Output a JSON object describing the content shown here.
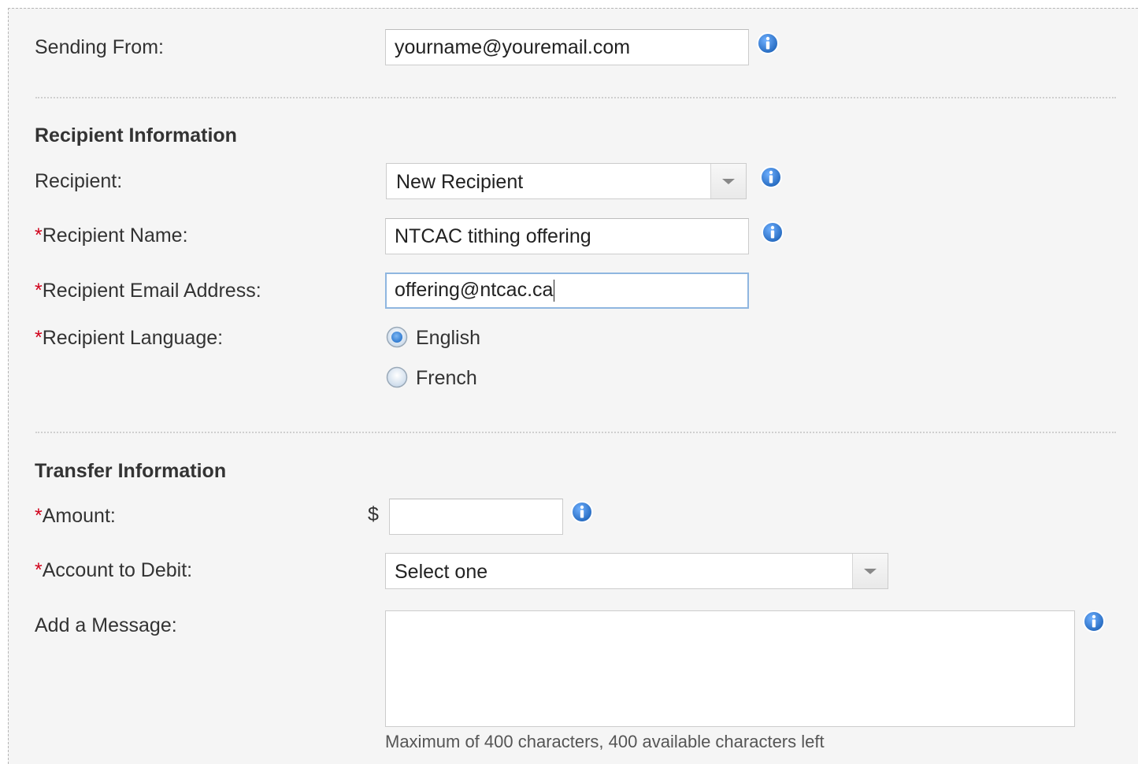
{
  "sending_from": {
    "label": "Sending From:",
    "value": "yourname@youremail.com"
  },
  "recipient_section": {
    "title": "Recipient Information",
    "recipient": {
      "label": "Recipient:",
      "selected": "New Recipient"
    },
    "recipient_name": {
      "required_mark": "*",
      "label": "Recipient Name:",
      "value": "NTCAC tithing offering"
    },
    "recipient_email": {
      "required_mark": "*",
      "label": "Recipient Email Address:",
      "value": "offering@ntcac.ca"
    },
    "recipient_language": {
      "required_mark": "*",
      "label": "Recipient Language:",
      "options": [
        {
          "label": "English",
          "selected": true
        },
        {
          "label": "French",
          "selected": false
        }
      ]
    }
  },
  "transfer_section": {
    "title": "Transfer Information",
    "amount": {
      "required_mark": "*",
      "label": "Amount:",
      "currency_symbol": "$",
      "value": ""
    },
    "account_to_debit": {
      "required_mark": "*",
      "label": "Account to Debit:",
      "selected": "Select one"
    },
    "message": {
      "label": "Add a Message:",
      "value": "",
      "hint": "Maximum of 400 characters, 400 available characters left"
    }
  },
  "icons": {
    "info": "info-icon"
  },
  "colors": {
    "required_mark": "#d0021b",
    "info_icon": "#2e7ad1",
    "focus_border": "#8fb6e0",
    "panel_background": "#f5f5f5"
  }
}
